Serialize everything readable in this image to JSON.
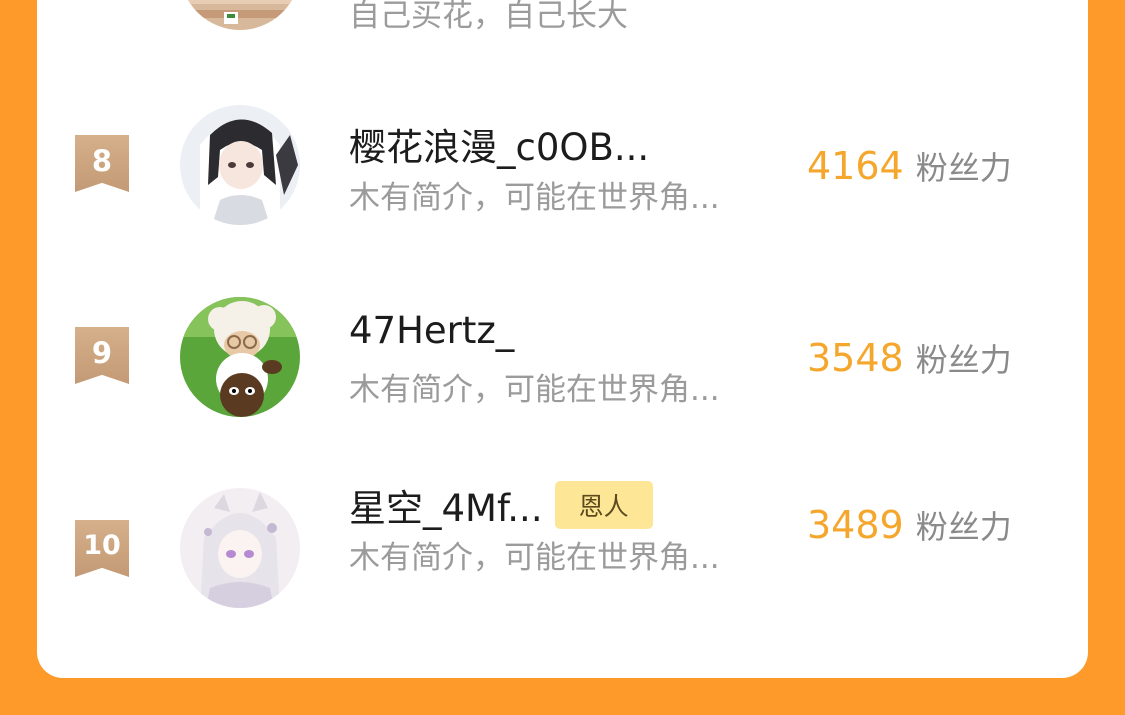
{
  "ranking": {
    "partial_item": {
      "bio": "自己买花，自己长大"
    },
    "items": [
      {
        "rank": "8",
        "name": "樱花浪漫_c0OB...",
        "bio": "木有简介，可能在世界角...",
        "score": "4164",
        "score_unit": "粉丝力",
        "tag": ""
      },
      {
        "rank": "9",
        "name": "47Hertz_",
        "bio": "木有简介，可能在世界角...",
        "score": "3548",
        "score_unit": "粉丝力",
        "tag": ""
      },
      {
        "rank": "10",
        "name": "星空_4Mf...",
        "bio": "木有简介，可能在世界角...",
        "score": "3489",
        "score_unit": "粉丝力",
        "tag": "恩人"
      }
    ]
  },
  "colors": {
    "background": "#fd9a29",
    "card": "#ffffff",
    "score": "#f4a72c",
    "rank_badge": "#c9a37f",
    "tag_bg": "#fde797"
  }
}
